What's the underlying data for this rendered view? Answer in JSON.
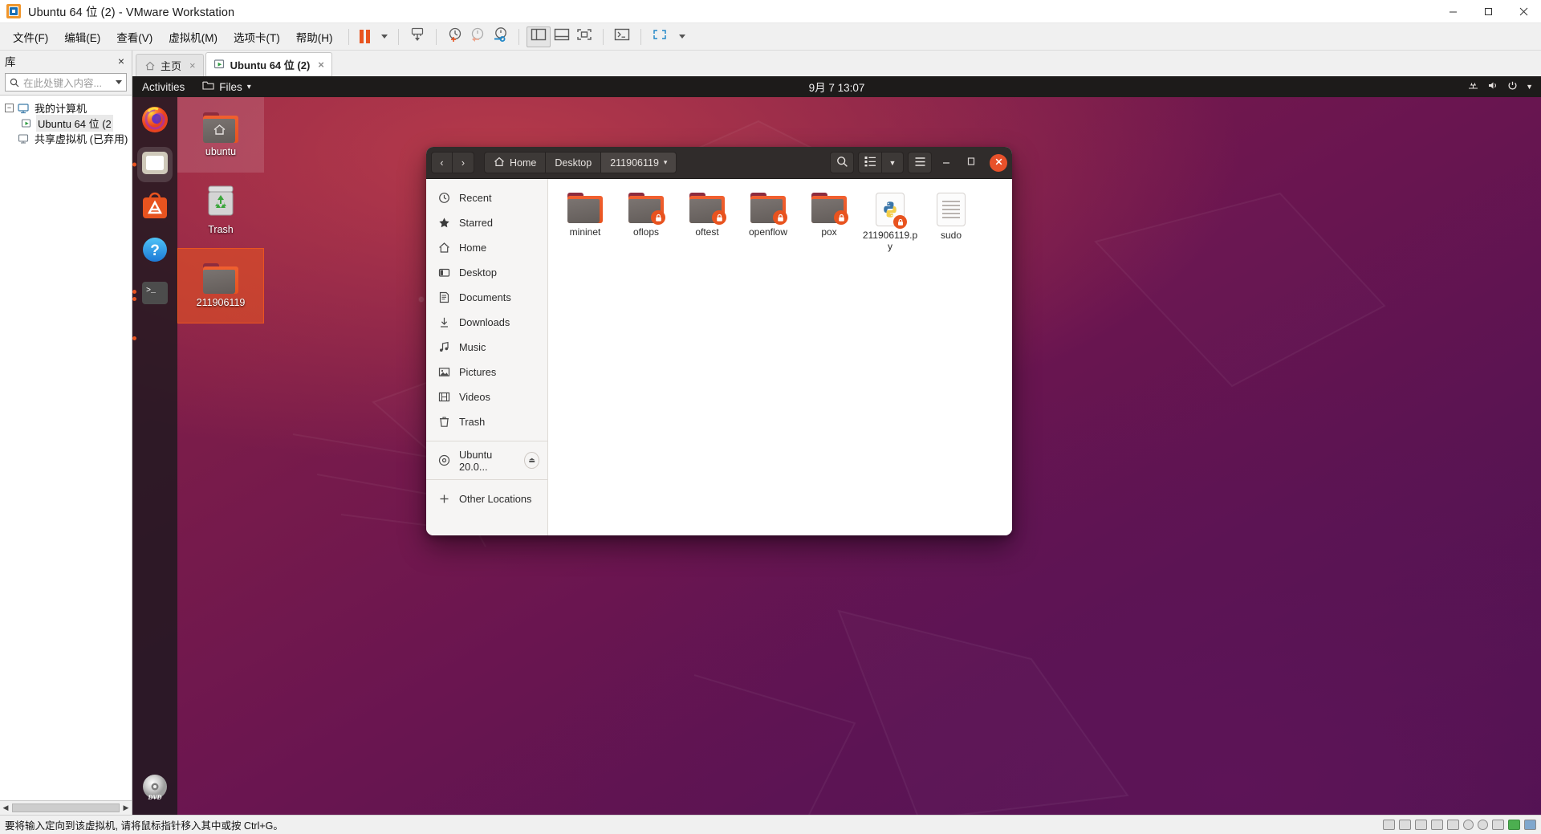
{
  "window": {
    "title": "Ubuntu 64 位 (2) - VMware Workstation",
    "minimize_label": "最小化",
    "maximize_label": "最大化",
    "close_label": "关闭"
  },
  "menubar": {
    "items": [
      {
        "label": "文件(F)",
        "name": "menu-file"
      },
      {
        "label": "编辑(E)",
        "name": "menu-edit"
      },
      {
        "label": "查看(V)",
        "name": "menu-view"
      },
      {
        "label": "虚拟机(M)",
        "name": "menu-vm"
      },
      {
        "label": "选项卡(T)",
        "name": "menu-tabs"
      },
      {
        "label": "帮助(H)",
        "name": "menu-help"
      }
    ]
  },
  "toolbar": {
    "buttons": [
      {
        "name": "suspend-button",
        "icon": "pause-icon"
      },
      {
        "name": "power-dropdown",
        "icon": "chevron-down-icon"
      },
      {
        "name": "send-ctrl-alt-del-button",
        "icon": "keyboard-send-icon"
      },
      {
        "name": "take-snapshot-button",
        "icon": "snapshot-add-icon"
      },
      {
        "name": "revert-snapshot-button",
        "icon": "snapshot-revert-icon"
      },
      {
        "name": "snapshot-manager-button",
        "icon": "snapshot-manage-icon"
      },
      {
        "name": "show-library-button",
        "icon": "panel-left-icon"
      },
      {
        "name": "show-thumbnail-bar-button",
        "icon": "panel-bottom-icon"
      },
      {
        "name": "show-console-view-button",
        "icon": "fullscreen-icon"
      },
      {
        "name": "unity-mode-button",
        "icon": "terminal-icon"
      },
      {
        "name": "fullscreen-button",
        "icon": "expand-icon"
      },
      {
        "name": "fullscreen-dropdown",
        "icon": "chevron-down-icon"
      }
    ]
  },
  "library": {
    "title": "库",
    "close_label": "×",
    "search_placeholder": "在此处键入内容...",
    "tree": [
      {
        "label": "我的计算机",
        "level": 1,
        "icon": "computer-icon",
        "expanded": true,
        "selected": false
      },
      {
        "label": "Ubuntu 64 位 (2",
        "level": 2,
        "icon": "vm-running-icon",
        "expanded": false,
        "selected": true
      },
      {
        "label": "共享虚拟机 (已弃用)",
        "level": 1,
        "icon": "shared-vm-icon",
        "expanded": false,
        "selected": false
      }
    ]
  },
  "tabs": [
    {
      "label": "主页",
      "icon": "home-icon",
      "active": false,
      "close": "×"
    },
    {
      "label": "Ubuntu 64 位 (2)",
      "icon": "vm-running-icon",
      "active": true,
      "close": "×"
    }
  ],
  "ubuntu": {
    "topbar": {
      "activities": "Activities",
      "app_name": "Files",
      "app_menu_caret": "▾",
      "clock": "9月 7  13:07",
      "indicators": [
        "network-icon",
        "volume-icon",
        "power-icon",
        "chevron-down-icon"
      ]
    },
    "dock": [
      {
        "name": "dock-item-firefox",
        "label": "Firefox",
        "icon": "firefox-icon",
        "running": false,
        "focused": false
      },
      {
        "name": "dock-item-files",
        "label": "Files",
        "icon": "files-icon",
        "running": true,
        "focused": true
      },
      {
        "name": "dock-item-software",
        "label": "Ubuntu Software",
        "icon": "ubuntu-software-icon",
        "running": false,
        "focused": false
      },
      {
        "name": "dock-item-help",
        "label": "Help",
        "icon": "help-icon",
        "running": false,
        "focused": false
      },
      {
        "name": "dock-item-terminal",
        "label": "Terminal",
        "icon": "terminal-icon",
        "running": true,
        "focused": false
      },
      {
        "name": "dock-item-unknown",
        "label": "",
        "icon": "running-indicator",
        "running": true,
        "focused": false
      },
      {
        "name": "dock-item-dvd",
        "label": "Ubuntu 20.0...",
        "icon": "dvd-icon",
        "running": false,
        "focused": false
      }
    ],
    "desktop_icons": [
      {
        "label": "ubuntu",
        "icon": "home-folder-icon",
        "state": "highlighted"
      },
      {
        "label": "Trash",
        "icon": "trash-icon",
        "state": "normal"
      },
      {
        "label": "211906119",
        "icon": "folder-icon",
        "state": "selected"
      }
    ]
  },
  "nautilus": {
    "nav": {
      "back": "‹",
      "forward": "›"
    },
    "breadcrumbs": [
      {
        "label": "Home",
        "icon": "home-icon",
        "current": false
      },
      {
        "label": "Desktop",
        "icon": "",
        "current": false
      },
      {
        "label": "211906119",
        "icon": "",
        "current": true,
        "caret": "▾"
      }
    ],
    "header_buttons": [
      {
        "name": "search-button",
        "icon": "search-icon"
      },
      {
        "name": "view-list-button",
        "icon": "list-view-icon"
      },
      {
        "name": "view-options-dropdown",
        "icon": "chevron-down-icon"
      },
      {
        "name": "hamburger-menu-button",
        "icon": "hamburger-icon"
      },
      {
        "name": "minimize-button",
        "icon": "minimize-icon"
      },
      {
        "name": "maximize-button",
        "icon": "maximize-icon"
      },
      {
        "name": "close-button",
        "icon": "close-icon"
      }
    ],
    "sidebar": [
      {
        "label": "Recent",
        "icon": "clock-icon"
      },
      {
        "label": "Starred",
        "icon": "star-icon"
      },
      {
        "label": "Home",
        "icon": "home-icon"
      },
      {
        "label": "Desktop",
        "icon": "desktop-icon"
      },
      {
        "label": "Documents",
        "icon": "document-icon"
      },
      {
        "label": "Downloads",
        "icon": "download-icon"
      },
      {
        "label": "Music",
        "icon": "music-icon"
      },
      {
        "label": "Pictures",
        "icon": "picture-icon"
      },
      {
        "label": "Videos",
        "icon": "video-icon"
      },
      {
        "label": "Trash",
        "icon": "trash-icon"
      }
    ],
    "devices": [
      {
        "label": "Ubuntu 20.0...",
        "icon": "disc-icon",
        "eject": "⏏"
      }
    ],
    "other": {
      "label": "Other Locations",
      "icon": "plus-icon"
    },
    "files": [
      {
        "name": "mininet",
        "type": "folder",
        "locked": false
      },
      {
        "name": "oflops",
        "type": "folder",
        "locked": true
      },
      {
        "name": "oftest",
        "type": "folder",
        "locked": true
      },
      {
        "name": "openflow",
        "type": "folder",
        "locked": true
      },
      {
        "name": "pox",
        "type": "folder",
        "locked": true
      },
      {
        "name": "211906119.py",
        "type": "python",
        "locked": true
      },
      {
        "name": "sudo",
        "type": "text",
        "locked": false
      }
    ]
  },
  "statusbar": {
    "message": "要将输入定向到该虚拟机, 请将鼠标指针移入其中或按 Ctrl+G。"
  },
  "colors": {
    "ubuntu_orange": "#e8531f",
    "vmware_orange": "#f0962c",
    "vmware_blue": "#1a6fb4",
    "nautilus_header": "#302c2b",
    "desktop_purple": "#5d1457"
  }
}
